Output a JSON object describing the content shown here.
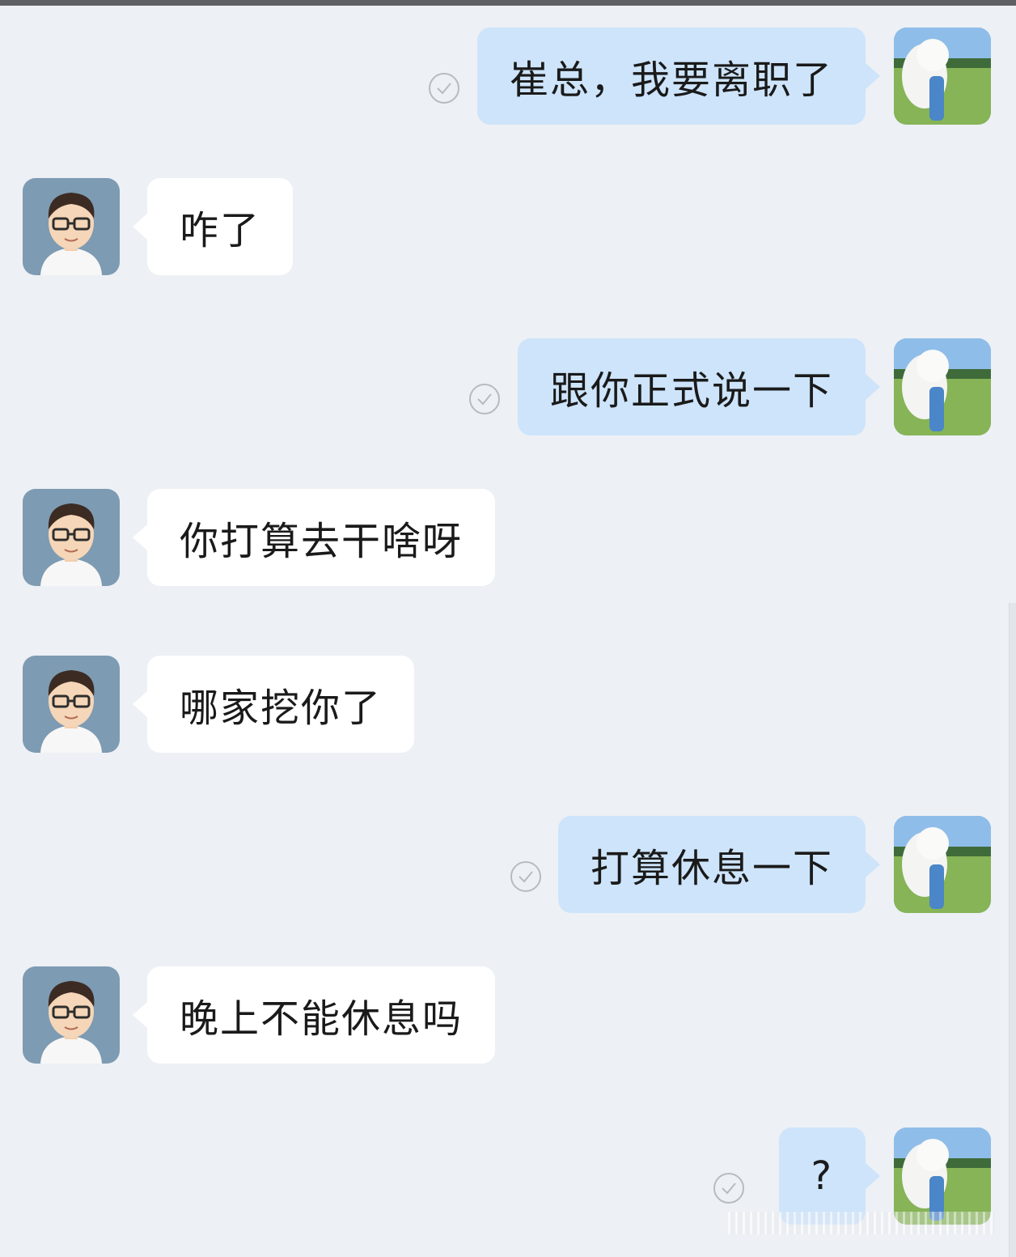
{
  "colors": {
    "background": "#edf0f4",
    "incoming_bubble": "#ffffff",
    "outgoing_bubble": "#cde4fb",
    "read_check": "#b7bbc1"
  },
  "icons": {
    "incoming_avatar": "cartoon-man-with-glasses-avatar",
    "outgoing_avatar": "white-dog-on-grass-avatar",
    "read_status": "check-circle-icon"
  },
  "messages": [
    {
      "direction": "outgoing",
      "text": "崔总，我要离职了",
      "status": "read"
    },
    {
      "direction": "incoming",
      "text": "咋了"
    },
    {
      "direction": "outgoing",
      "text": "跟你正式说一下",
      "status": "read"
    },
    {
      "direction": "incoming",
      "text": "你打算去干啥呀"
    },
    {
      "direction": "incoming",
      "text": "哪家挖你了"
    },
    {
      "direction": "outgoing",
      "text": "打算休息一下",
      "status": "read"
    },
    {
      "direction": "incoming",
      "text": "晚上不能休息吗"
    },
    {
      "direction": "outgoing",
      "text": "?",
      "status": "read"
    }
  ]
}
